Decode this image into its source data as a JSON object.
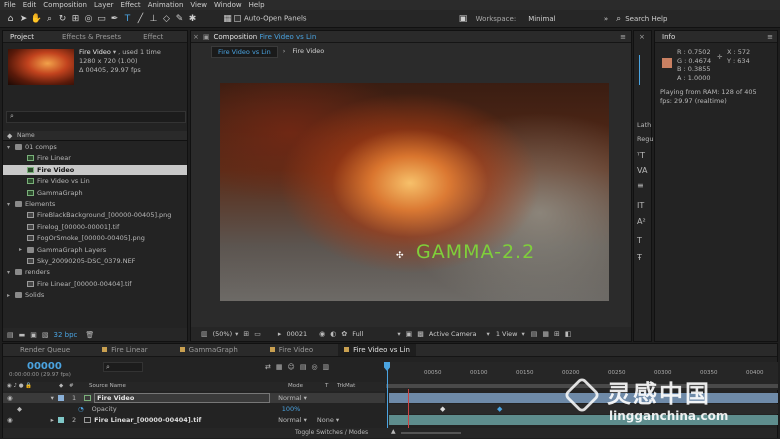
{
  "menu": [
    "File",
    "Edit",
    "Composition",
    "Layer",
    "Effect",
    "Animation",
    "View",
    "Window",
    "Help"
  ],
  "toolbar": {
    "auto_open_label": "Auto-Open Panels",
    "workspace_label": "Workspace:",
    "workspace_value": "Minimal",
    "search_help": "Search Help"
  },
  "project": {
    "tabs": [
      "Project",
      "Effects & Presets",
      "Effect"
    ],
    "selected_name": "Fire Video",
    "used": ", used 1 time",
    "dims": "1280 x 720 (1.00)",
    "duration": "Δ 00405, 29.97 fps",
    "column_name": "Name",
    "bpc": "32 bpc",
    "items": [
      {
        "label": "01 comps",
        "type": "folder",
        "depth": 0,
        "open": true
      },
      {
        "label": "Fire Linear",
        "type": "comp",
        "depth": 1
      },
      {
        "label": "Fire Video",
        "type": "comp",
        "depth": 1,
        "selected": true
      },
      {
        "label": "Fire Video vs Lin",
        "type": "comp",
        "depth": 1
      },
      {
        "label": "GammaGraph",
        "type": "comp",
        "depth": 1
      },
      {
        "label": "Elements",
        "type": "folder",
        "depth": 0,
        "open": true
      },
      {
        "label": "FireBlackBackground_[00000-00405].png",
        "type": "footage",
        "depth": 1
      },
      {
        "label": "Firelog_[00000-00001].tif",
        "type": "footage",
        "depth": 1
      },
      {
        "label": "FogOrSmoke_[00000-00405].png",
        "type": "footage",
        "depth": 1
      },
      {
        "label": "GammaGraph Layers",
        "type": "folder",
        "depth": 1,
        "open": false
      },
      {
        "label": "Sky_20090205-DSC_0379.NEF",
        "type": "footage",
        "depth": 1
      },
      {
        "label": "renders",
        "type": "folder",
        "depth": 0,
        "open": true
      },
      {
        "label": "Fire Linear_[00000-00404].tif",
        "type": "footage",
        "depth": 1
      },
      {
        "label": "Solids",
        "type": "folder",
        "depth": 0,
        "open": false
      }
    ]
  },
  "composition": {
    "tab_prefix": "Composition",
    "tab_name": "Fire Video vs Lin",
    "subtabs": [
      "Fire Video vs Lin",
      "Fire Video"
    ],
    "overlay_text": "GAMMA-2.2",
    "zoom": "(50%)",
    "frame": "00021",
    "resolution": "Full",
    "camera": "Active Camera",
    "view": "1 View"
  },
  "info": {
    "tab": "Info",
    "r": "R : 0.7502",
    "g": "G : 0.4674",
    "b": "B : 0.3855",
    "a": "A : 1.0000",
    "x": "X : 572",
    "y": "Y : 634",
    "playing": "Playing from RAM: 128 of 405",
    "fps": "fps: 29.97 (realtime)",
    "swatch": "#c98062"
  },
  "side_labels": [
    "Lath",
    "Regu"
  ],
  "timeline": {
    "tabs": [
      "Render Queue",
      "Fire Linear",
      "GammaGraph",
      "Fire Video",
      "Fire Video vs Lin"
    ],
    "timecode": "00000",
    "timecode_sub": "0:00:00:00 (29.97 fps)",
    "col_source": "Source Name",
    "col_mode": "Mode",
    "col_t": "T",
    "col_trkmat": "TrkMat",
    "ruler": [
      "00050",
      "00100",
      "00150",
      "00200",
      "00250",
      "00300",
      "00350",
      "00400"
    ],
    "layers": [
      {
        "num": "1",
        "name": "Fire Video",
        "mode": "Normal",
        "trkmat": ""
      },
      {
        "num": "2",
        "name": "Fire Linear_[00000-00404].tif",
        "mode": "Normal",
        "trkmat": "None"
      }
    ],
    "prop_name": "Opacity",
    "prop_value": "100%",
    "toggle": "Toggle Switches / Modes"
  },
  "watermark": {
    "title": "灵感中国",
    "url": "lingganchina.com"
  }
}
